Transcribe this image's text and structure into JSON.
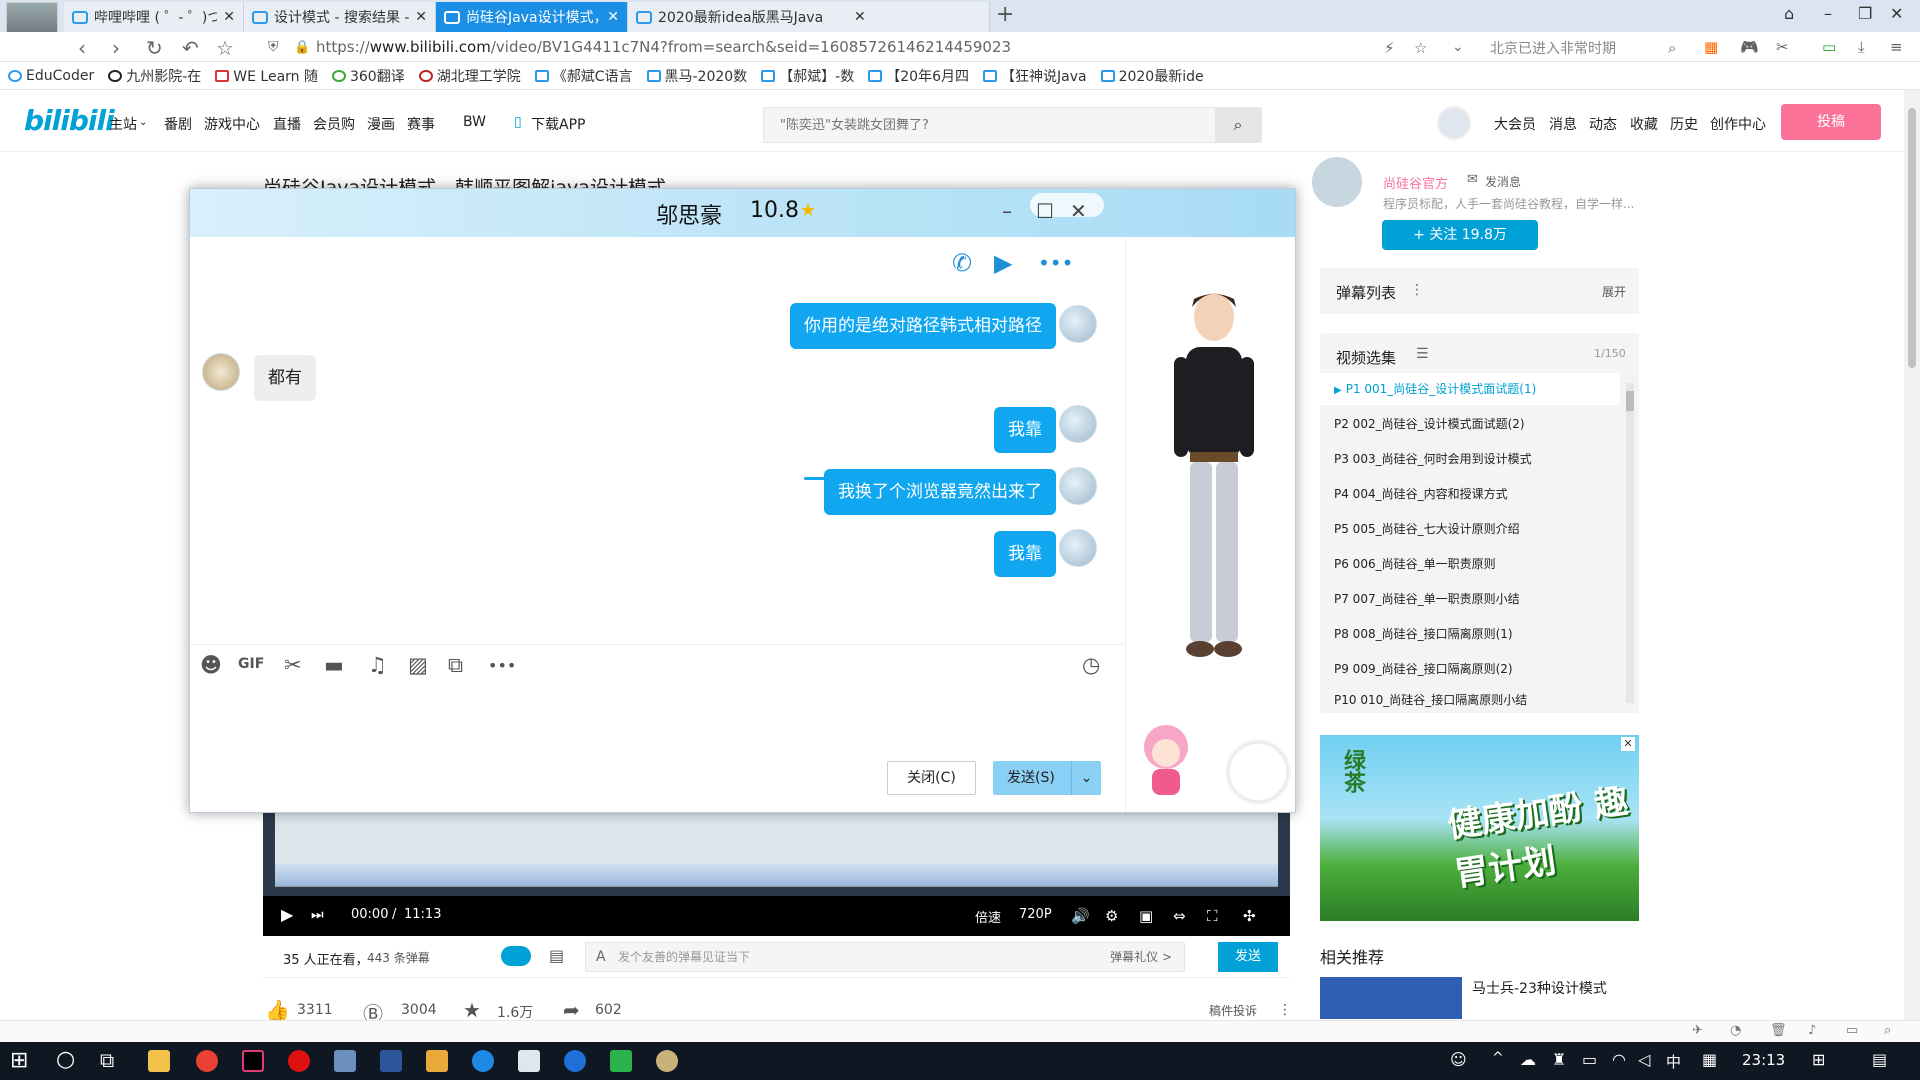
{
  "browser": {
    "tabs": [
      {
        "label": "哔哩哔哩 ( ゜- ゜)つロ 干杯",
        "active": false
      },
      {
        "label": "设计模式 - 搜索结果 - 哔哩",
        "active": false
      },
      {
        "label": "尚硅谷Java设计模式，韩",
        "active": true
      },
      {
        "label": "2020最新idea版黑马Java",
        "active": false
      }
    ],
    "new_tab": "+",
    "url_prefix": "https://",
    "url_domain": "www.bilibili.com",
    "url_path": "/video/BV1G4411c7N4?from=search&seid=16085726146214459023",
    "addr_right": "北京已进入非常时期",
    "bookmarks": [
      "EduCoder",
      "九州影院-在",
      "WE Learn 随",
      "360翻译",
      "湖北理工学院",
      "《郝斌C语言",
      "黑马-2020数",
      "【郝斌】-数",
      "【20年6月四",
      "【狂神说Java",
      "2020最新ide"
    ]
  },
  "bili": {
    "logo": "bilibili",
    "nav": [
      "主站",
      "番剧",
      "游戏中心",
      "直播",
      "会员购",
      "漫画",
      "赛事",
      "BW",
      "下载APP"
    ],
    "search_placeholder": "\"陈奕迅\"女装跳女团舞了?",
    "user_nav": [
      "大会员",
      "消息",
      "动态",
      "收藏",
      "历史",
      "创作中心"
    ],
    "upload": "投稿"
  },
  "video": {
    "title": "尚硅谷Java设计模式，韩顺平图解java设计模式",
    "time_current": "00:00",
    "time_sep": "/",
    "time_total": "11:13",
    "speed": "倍速",
    "quality": "720P",
    "watching": "35 人正在看，",
    "danmaku_count": "443 条弹幕",
    "danmaku_placeholder": "发个友善的弹幕见证当下",
    "danmaku_etiquette": "弹幕礼仪 >",
    "danmaku_send": "发送",
    "likes": "3311",
    "coins": "3004",
    "favorites": "1.6万",
    "shares": "602",
    "report": "稿件投诉"
  },
  "uploader": {
    "name": "尚硅谷官方",
    "message": "发消息",
    "desc": "程序员标配，人手一套尚硅谷教程，自学一样...",
    "follow": "+ 关注 19.8万"
  },
  "danmaku_list": {
    "title": "弹幕列表",
    "expand": "展开"
  },
  "episodes": {
    "title": "视频选集",
    "count": "1/150",
    "items": [
      "P1  001_尚硅谷_设计模式面试题(1)",
      "P2  002_尚硅谷_设计模式面试题(2)",
      "P3  003_尚硅谷_何时会用到设计模式",
      "P4  004_尚硅谷_内容和授课方式",
      "P5  005_尚硅谷_七大设计原则介绍",
      "P6  006_尚硅谷_单一职责原则",
      "P7  007_尚硅谷_单一职责原则小结",
      "P8  008_尚硅谷_接口隔离原则(1)",
      "P9  009_尚硅谷_接口隔离原则(2)",
      "P10  010_尚硅谷_接口隔离原则小结"
    ]
  },
  "ad": {
    "text": "健康加酚 趣胃计划",
    "brand": "绿茶"
  },
  "related": {
    "title": "相关推荐",
    "item": "马士兵-23种设计模式"
  },
  "chat": {
    "contact_name": "邬思豪",
    "contact_level": "10.8",
    "messages": [
      {
        "from": "me",
        "text": "你用的是绝对路径韩式相对路径"
      },
      {
        "from": "peer",
        "text": "都有"
      },
      {
        "from": "me",
        "text": "我靠"
      },
      {
        "from": "me",
        "text": "我换了个浏览器竟然出来了"
      },
      {
        "from": "me",
        "text": "我靠"
      }
    ],
    "close_label": "关闭(C)",
    "send_label": "发送(S)"
  },
  "taskbar": {
    "ime": "中",
    "time": "23:13"
  }
}
